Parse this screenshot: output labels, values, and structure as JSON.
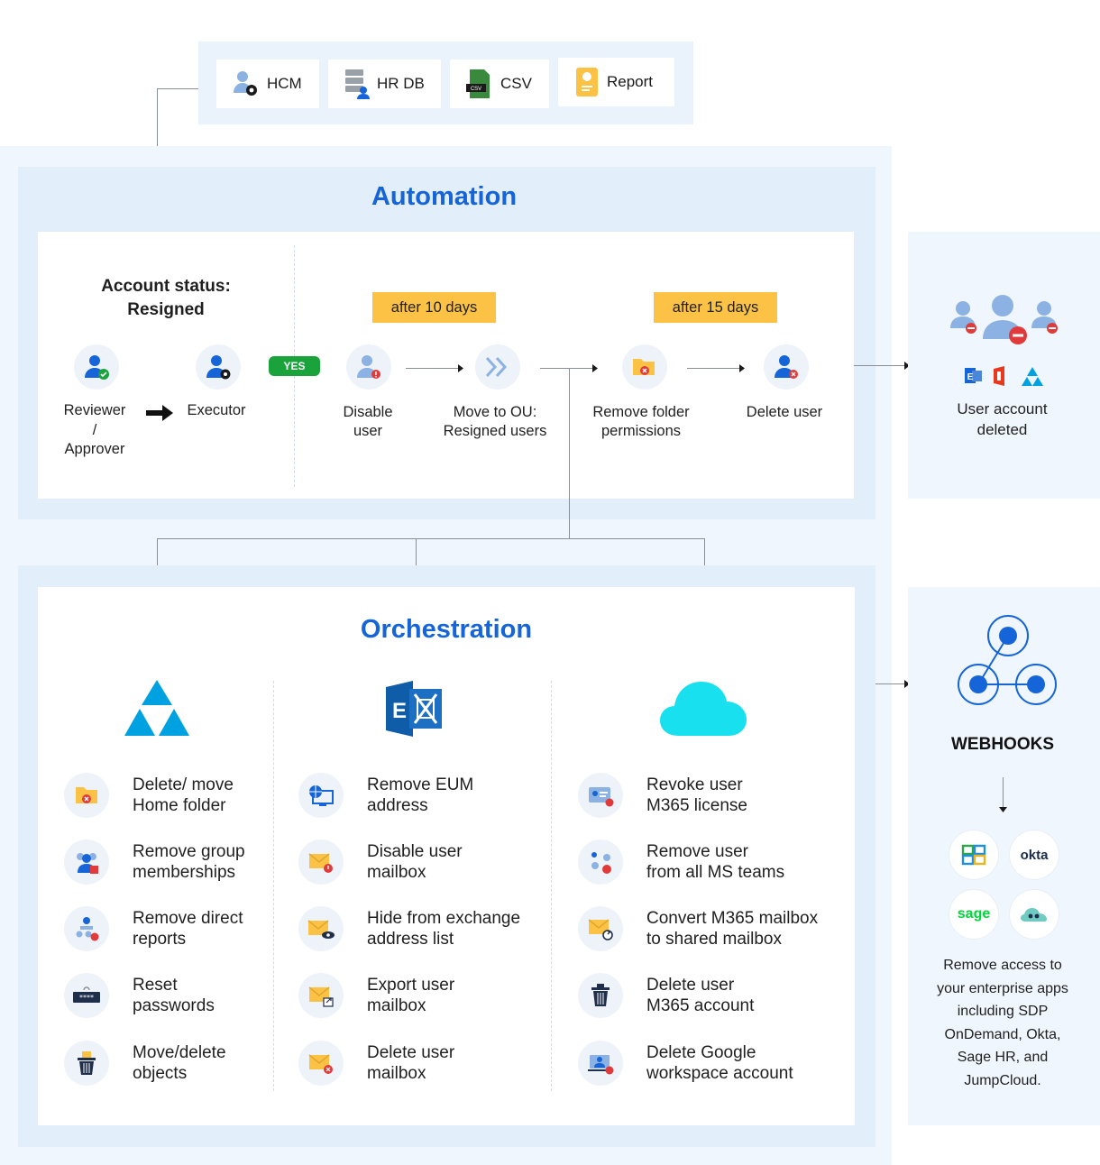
{
  "sources": [
    {
      "label": "HCM",
      "icon": "hcm-icon"
    },
    {
      "label": "HR DB",
      "icon": "database-icon"
    },
    {
      "label": "CSV",
      "icon": "csv-file-icon"
    },
    {
      "label": "Report",
      "icon": "report-icon"
    }
  ],
  "automation": {
    "title": "Automation",
    "status_line1": "Account status:",
    "status_line2": "Resigned",
    "reviewer_line1": "Reviewer",
    "reviewer_line2": "/",
    "reviewer_line3": "Approver",
    "executor": "Executor",
    "yes": "YES",
    "badge1": "after 10 days",
    "badge2": "after 15 days",
    "steps": [
      {
        "line1": "Disable",
        "line2": "user"
      },
      {
        "line1": "Move to OU:",
        "line2": "Resigned users"
      },
      {
        "line1": "Remove folder",
        "line2": "permissions"
      },
      {
        "line1": "Delete user",
        "line2": ""
      }
    ]
  },
  "deleted_panel": {
    "line1": "User account",
    "line2": "deleted"
  },
  "orchestration": {
    "title": "Orchestration",
    "columns": [
      {
        "logo": "azure-ad-icon",
        "items": [
          {
            "text": "Delete/ move\nHome folder",
            "icon": "folder-delete-icon"
          },
          {
            "text": "Remove group\nmemberships",
            "icon": "group-remove-icon"
          },
          {
            "text": "Remove direct\nreports",
            "icon": "org-chart-icon"
          },
          {
            "text": "Reset\npasswords",
            "icon": "password-icon"
          },
          {
            "text": "Move/delete\nobjects",
            "icon": "trash-icon"
          }
        ]
      },
      {
        "logo": "exchange-icon",
        "items": [
          {
            "text": "Remove EUM\naddress",
            "icon": "globe-monitor-icon"
          },
          {
            "text": "Disable user\nmailbox",
            "icon": "mail-alert-icon"
          },
          {
            "text": "Hide from exchange\naddress list",
            "icon": "mail-eye-icon"
          },
          {
            "text": "Export user\nmailbox",
            "icon": "mail-export-icon"
          },
          {
            "text": "Delete user\nmailbox",
            "icon": "mail-delete-icon"
          }
        ]
      },
      {
        "logo": "cloud-icon",
        "items": [
          {
            "text": "Revoke user\nM365 license",
            "icon": "license-icon"
          },
          {
            "text": "Remove user\nfrom all MS teams",
            "icon": "teams-remove-icon"
          },
          {
            "text": "Convert M365 mailbox\nto shared mailbox",
            "icon": "mail-convert-icon"
          },
          {
            "text": "Delete user\nM365 account",
            "icon": "trash-icon"
          },
          {
            "text": "Delete Google\nworkspace account",
            "icon": "google-account-delete-icon"
          }
        ]
      }
    ]
  },
  "webhooks": {
    "title": "WEBHOOKS",
    "apps": [
      {
        "label": "",
        "icon": "sdp-icon"
      },
      {
        "label": "okta",
        "icon": "okta-logo"
      },
      {
        "label": "sage",
        "icon": "sage-logo"
      },
      {
        "label": "",
        "icon": "jumpcloud-icon"
      }
    ],
    "desc": "Remove access to\nyour enterprise apps\nincluding SDP\nOnDemand, Okta,\nSage HR, and\nJumpCloud."
  },
  "colors": {
    "accent": "#1565d8",
    "badge": "#fbc246",
    "yes": "#1aa33a",
    "panel": "#e3eefb"
  }
}
